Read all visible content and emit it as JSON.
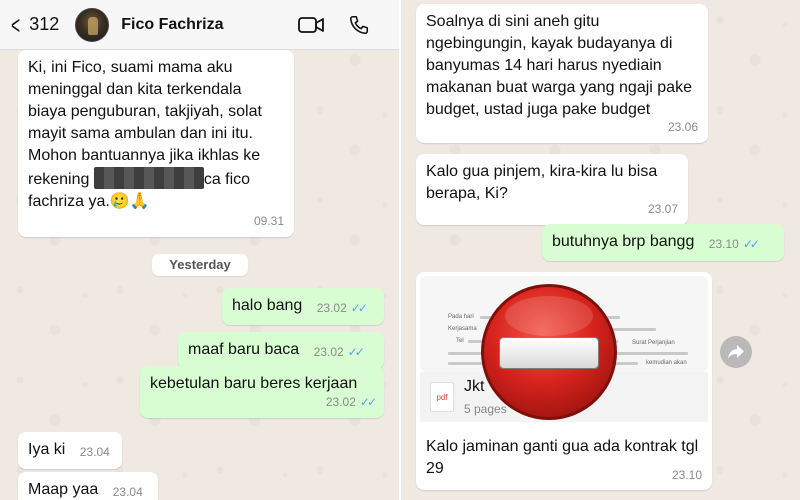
{
  "header": {
    "back_count": "312",
    "contact_name": "Fico Fachriza",
    "back_icon": "chevron-left-icon",
    "video_icon": "video-call-icon",
    "phone_icon": "phone-icon"
  },
  "left_messages": {
    "msg1": {
      "text_a": "Ki, ini Fico, suami mama aku meninggal dan kita terkendala biaya penguburan, takjiyah, solat mayit sama ambulan dan ini itu. Mohon bantuannya jika ikhlas ke rekening",
      "text_b": "ca fico fachriza ya.",
      "emoji": "🥲🙏",
      "time": "09.31"
    },
    "date_divider": "Yesterday",
    "msg2": {
      "text": "halo bang",
      "time": "23.02"
    },
    "msg3": {
      "text": "maaf baru baca",
      "time": "23.02"
    },
    "msg4": {
      "text": "kebetulan baru beres kerjaan",
      "time": "23.02"
    },
    "msg5": {
      "text": "Iya ki",
      "time": "23.04"
    },
    "msg6": {
      "text": "Maap yaa",
      "time": "23.04"
    }
  },
  "right_messages": {
    "msg1": {
      "text": "Soalnya di sini aneh gitu ngebingungin, kayak budayanya di banyumas 14 hari harus nyediain makanan buat warga yang ngaji pake budget, ustad juga pake budget",
      "time": "23.06"
    },
    "msg2": {
      "text": "Kalo gua pinjem, kira-kira lu bisa berapa, Ki?",
      "time": "23.07"
    },
    "msg3": {
      "text": "butuhnya brp bangg",
      "time": "23.10"
    },
    "doc": {
      "preview_words": [
        "Pada hari",
        "Kerjasama",
        "Tel",
        "Surat Perjanjian",
        "kemudian akan"
      ],
      "file_type": "pdf",
      "file_name": "Jkt",
      "file_pages": "5 pages",
      "caption": "Kalo jaminan ganti gua ada kontrak tgl 29",
      "time": "23.10"
    }
  },
  "overlay": {
    "icon": "no-entry-icon",
    "color": "#d8231c"
  },
  "forward_icon": "forward-icon",
  "colors": {
    "incoming": "#ffffff",
    "outgoing": "#d9fdd3",
    "read_tick": "#4fa4e8"
  }
}
